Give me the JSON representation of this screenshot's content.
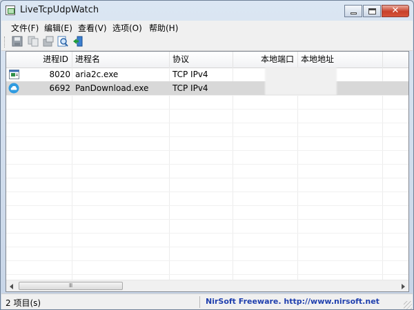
{
  "window": {
    "title": "LiveTcpUdpWatch",
    "close_symbol": "✕"
  },
  "menu": [
    "文件(F)",
    "编辑(E)",
    "查看(V)",
    "选项(O)",
    "帮助(H)"
  ],
  "toolbar": {
    "buttons": [
      "save-icon",
      "copy-icon",
      "properties-icon",
      "find-icon",
      "exit-icon"
    ]
  },
  "table": {
    "columns": [
      "进程ID",
      "进程名",
      "协议",
      "本地端口",
      "本地地址"
    ],
    "rows": [
      {
        "icon": "aria2c-app-icon",
        "pid": "8020",
        "name": "aria2c.exe",
        "protocol": "TCP IPv4"
      },
      {
        "icon": "pandownload-cloud-icon",
        "pid": "6692",
        "name": "PanDownload.exe",
        "protocol": "TCP IPv4"
      }
    ]
  },
  "scrollbar": {
    "thumb_glyph": "Ⅲ"
  },
  "status": {
    "item_count": "2 项目(s)",
    "credit": "NirSoft Freeware.  http://www.nirsoft.net"
  }
}
